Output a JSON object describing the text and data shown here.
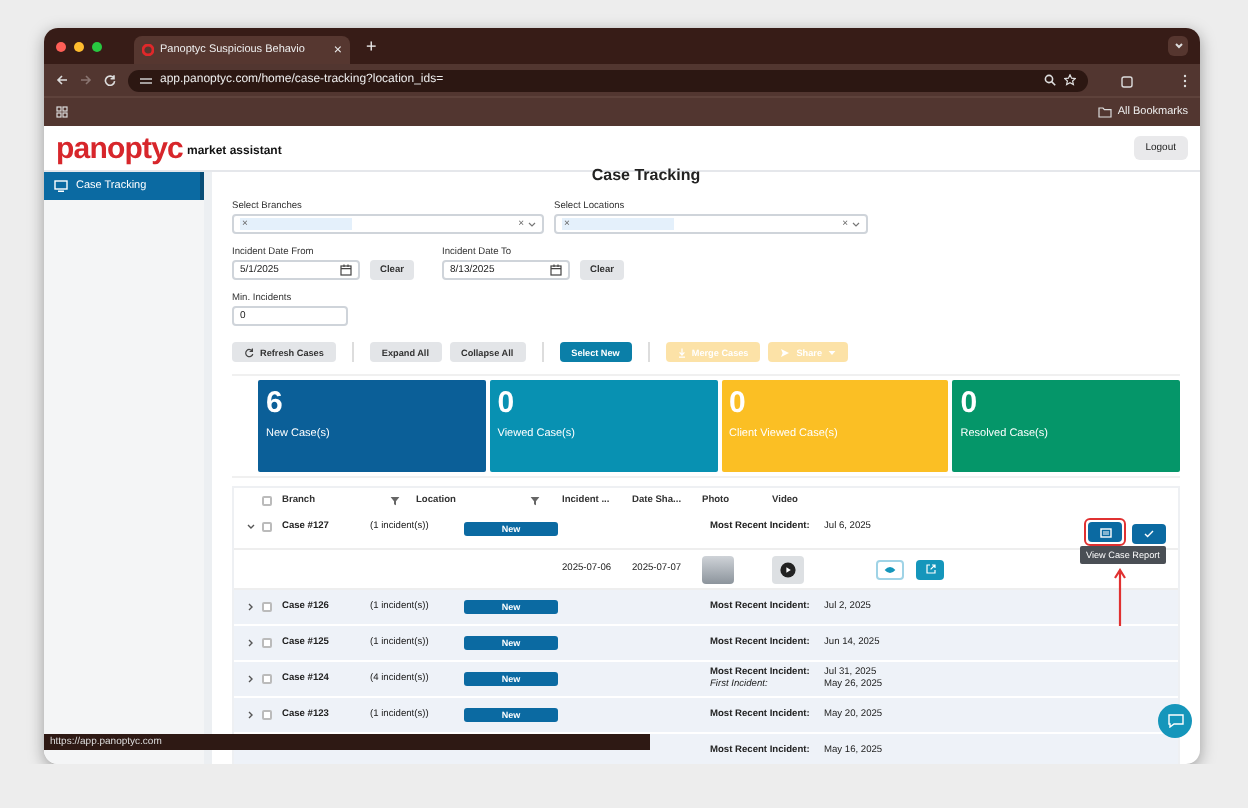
{
  "browser": {
    "tab_title": "Panoptyc Suspicious Behavio",
    "tab_close": "×",
    "new_tab": "+",
    "url": "app.panoptyc.com/home/case-tracking?location_ids=",
    "bookmarks": "All Bookmarks"
  },
  "header": {
    "logo": "panoptyc",
    "tagline": "market assistant",
    "logout": "Logout"
  },
  "sidebar": {
    "items": [
      {
        "label": "Case Tracking",
        "selected": true
      }
    ]
  },
  "title": "Case Tracking",
  "filters": {
    "selects": [
      {
        "label": "Select Branches",
        "chip_remove": "×",
        "clear": "×"
      },
      {
        "label": "Select Locations",
        "chip_remove": "×",
        "clear": "×"
      }
    ],
    "dates": [
      {
        "label": "Incident Date From",
        "value": "5/1/2025",
        "clear": "Clear"
      },
      {
        "label": "Incident Date To",
        "value": "8/13/2025",
        "clear": "Clear"
      }
    ],
    "min_incidents": {
      "label": "Min. Incidents",
      "value": "0"
    }
  },
  "toolbar": [
    [
      {
        "label": "Refresh Cases",
        "kind": "refresh",
        "disabled": false
      }
    ],
    [
      {
        "label": "Expand All",
        "kind": "plain",
        "disabled": false
      },
      {
        "label": "Collapse All",
        "kind": "plain",
        "disabled": false
      }
    ],
    [
      {
        "label": "Select New",
        "kind": "primary",
        "disabled": false
      }
    ],
    [
      {
        "label": "Merge Cases",
        "kind": "merge",
        "disabled": true
      },
      {
        "label": "Share",
        "kind": "share",
        "disabled": true
      }
    ]
  ],
  "stats": [
    {
      "count": "6",
      "label": "New Case(s)",
      "color": "#0b5f98"
    },
    {
      "count": "0",
      "label": "Viewed Case(s)",
      "color": "#0891b2"
    },
    {
      "count": "0",
      "label": "Client Viewed Case(s)",
      "color": "#fbbf24"
    },
    {
      "count": "0",
      "label": "Resolved Case(s)",
      "color": "#059669"
    }
  ],
  "table": {
    "select_all_checked": false,
    "columns": [
      {
        "label": "Branch",
        "filter": true
      },
      {
        "label": "Location",
        "filter": true
      },
      {
        "label": "Incident ...",
        "filter": false
      },
      {
        "label": "Date Sha...",
        "filter": false
      },
      {
        "label": "Photo",
        "filter": false
      },
      {
        "label": "Video",
        "filter": false
      }
    ],
    "rows": [
      {
        "case": "Case #127",
        "incidents": "(1 incident(s))",
        "status": "New",
        "expanded": true,
        "checked": false,
        "hovered": true,
        "recent_label": "Most Recent Incident:",
        "recent_date": "Jul 6, 2025",
        "detail": {
          "incident_date": "2025-07-06",
          "date_shared": "2025-07-07"
        }
      },
      {
        "case": "Case #126",
        "incidents": "(1 incident(s))",
        "status": "New",
        "expanded": false,
        "checked": false,
        "hovered": false,
        "recent_label": "Most Recent Incident:",
        "recent_date": "Jul 2, 2025"
      },
      {
        "case": "Case #125",
        "incidents": "(1 incident(s))",
        "status": "New",
        "expanded": false,
        "checked": false,
        "hovered": false,
        "recent_label": "Most Recent Incident:",
        "recent_date": "Jun 14, 2025"
      },
      {
        "case": "Case #124",
        "incidents": "(4 incident(s))",
        "status": "New",
        "expanded": false,
        "checked": false,
        "hovered": false,
        "recent_label": "Most Recent Incident:",
        "recent_date": "Jul 31, 2025",
        "first_label": "First Incident:",
        "first_date": "May 26, 2025"
      },
      {
        "case": "Case #123",
        "incidents": "(1 incident(s))",
        "status": "New",
        "expanded": false,
        "checked": false,
        "hovered": false,
        "recent_label": "Most Recent Incident:",
        "recent_date": "May 20, 2025"
      },
      {
        "recent_label": "Most Recent Incident:",
        "recent_date": "May 16, 2025"
      }
    ]
  },
  "tooltip": "View Case Report",
  "status_url": "https://app.panoptyc.com"
}
